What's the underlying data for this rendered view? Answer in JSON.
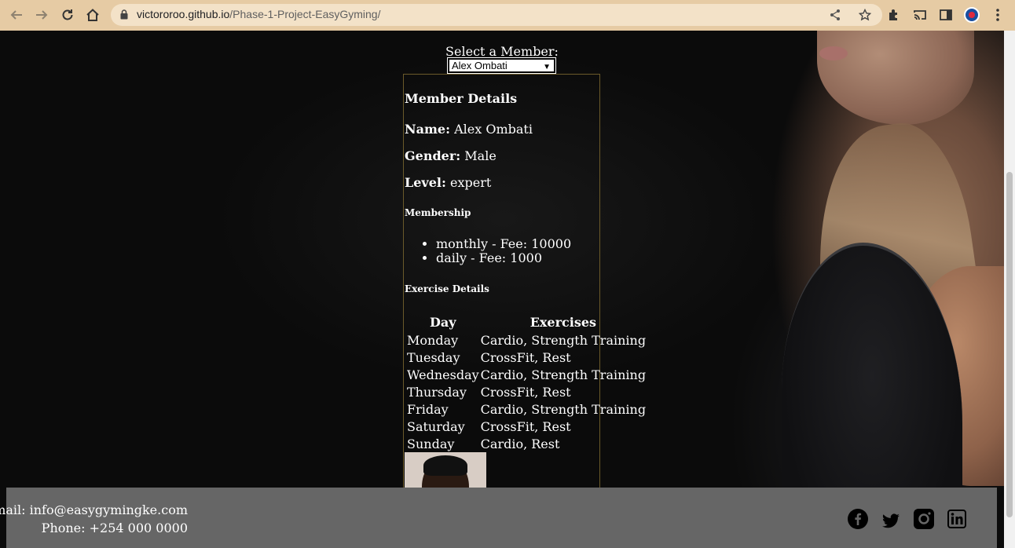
{
  "browser": {
    "url_domain": "victororoo.github.io",
    "url_path": "/Phase-1-Project-EasyGyming/"
  },
  "page": {
    "select_label": "Select a Member:",
    "selected_member": "Alex Ombati",
    "details": {
      "heading": "Member Details",
      "name_label": "Name:",
      "name_value": "Alex Ombati",
      "gender_label": "Gender:",
      "gender_value": "Male",
      "level_label": "Level:",
      "level_value": "expert",
      "membership_heading": "Membership",
      "memberships": [
        "monthly - Fee: 10000",
        "daily - Fee: 1000"
      ],
      "exercise_heading": "Exercise Details",
      "table_headers": [
        "Day",
        "Exercises"
      ],
      "schedule": [
        [
          "Monday",
          "Cardio, Strength Training"
        ],
        [
          "Tuesday",
          "CrossFit, Rest"
        ],
        [
          "Wednesday",
          "Cardio, Strength Training"
        ],
        [
          "Thursday",
          "CrossFit, Rest"
        ],
        [
          "Friday",
          "Cardio, Strength Training"
        ],
        [
          "Saturday",
          "CrossFit, Rest"
        ],
        [
          "Sunday",
          "Cardio, Rest"
        ]
      ]
    }
  },
  "footer": {
    "email": "Email: info@easygymingke.com",
    "phone": "Phone: +254 000 0000",
    "social_icons": [
      "facebook-icon",
      "twitter-icon",
      "instagram-icon",
      "linkedin-icon"
    ]
  }
}
